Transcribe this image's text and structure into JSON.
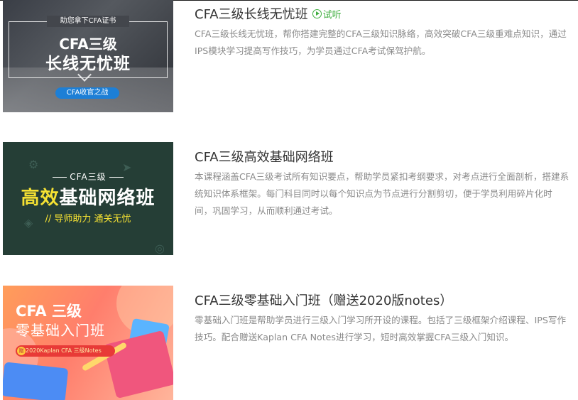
{
  "courses": [
    {
      "title": "CFA三级长线无忧班",
      "trial_label": "试听",
      "description": "CFA三级长线无忧班，帮你搭建完整的CFA三级知识脉络，高效突破CFA三级重难点知识，通过IPS模块学习提高写作技巧，为学员通过CFA考试保驾护航。",
      "thumb": {
        "top_text": "助您拿下CFA证书",
        "line1": "CFA三级",
        "line2": "长线无忧班",
        "badge": "CFA收官之战"
      }
    },
    {
      "title": "CFA三级高效基础网络班",
      "description": "本课程涵盖CFA三级考试所有知识要点，帮助学员紧扣考纲要求，对考点进行全面剖析，搭建系统知识体系框架。每门科目同时以每个知识点为节点进行分割剪切，便于学员利用碎片化时间，巩固学习，从而顺利通过考试。",
      "thumb": {
        "sub": "CFA三级",
        "main_highlight": "高效",
        "main_rest": "基础网络班",
        "tagline": "// 导师助力  通关无忧"
      }
    },
    {
      "title": "CFA三级零基础入门班（赠送2020版notes）",
      "description": "零基础入门班是帮助学员进行三级入门学习所开设的课程。包括了三级框架介绍课程、IPS写作技巧。配合赠送Kaplan CFA Notes进行学习，短时高效掌握CFA三级入门知识。",
      "thumb": {
        "head": "CFA 三级",
        "head2": "零基础入门班",
        "coin": "赠",
        "pill": "2020Kaplan CFA 三级Notes"
      }
    }
  ],
  "colors": {
    "title": "#333333",
    "description": "#8a8a8a",
    "trial": "#3fae3f"
  }
}
